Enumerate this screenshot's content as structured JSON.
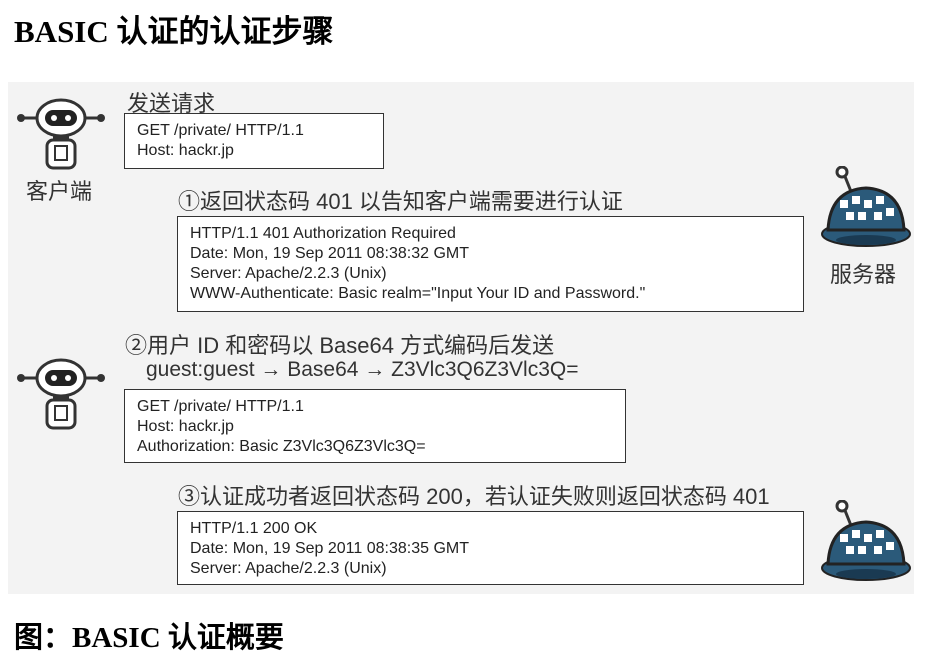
{
  "title": "BASIC 认证的认证步骤",
  "caption": "图：BASIC 认证概要",
  "client_label": "客户端",
  "server_label": "服务器",
  "send_request_label": "发送请求",
  "request1": [
    "GET /private/ HTTP/1.1",
    "Host: hackr.jp"
  ],
  "step1": "①返回状态码 401 以告知客户端需要进行认证",
  "response1": [
    "HTTP/1.1 401 Authorization Required",
    "Date: Mon, 19 Sep 2011 08:38:32 GMT",
    "Server: Apache/2.2.3 (Unix)",
    "WWW-Authenticate: Basic realm=\"Input Your ID and Password.\""
  ],
  "step2": "②用户 ID 和密码以 Base64 方式编码后发送",
  "encoding": "guest:guest → Base64 → Z3Vlc3Q6Z3Vlc3Q=",
  "request2": [
    "GET /private/ HTTP/1.1",
    "Host: hackr.jp",
    "Authorization: Basic Z3Vlc3Q6Z3Vlc3Q="
  ],
  "step3": "③认证成功者返回状态码 200，若认证失败则返回状态码 401",
  "response2": [
    "HTTP/1.1 200 OK",
    "Date: Mon, 19 Sep 2011 08:38:35 GMT",
    "Server: Apache/2.2.3 (Unix)"
  ],
  "icons": [
    "client-robot-icon",
    "server-robot-icon"
  ]
}
